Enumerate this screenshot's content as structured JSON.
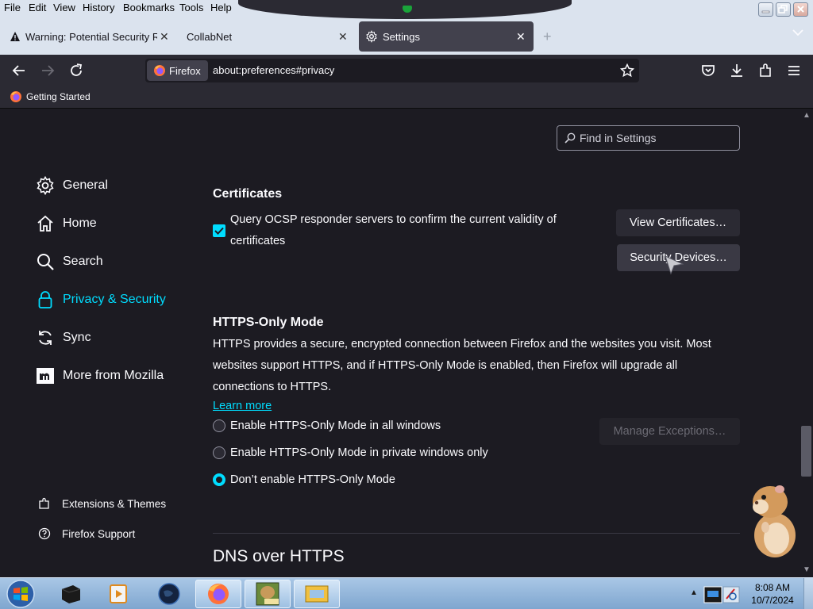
{
  "menubar": {
    "items": [
      {
        "label": "File"
      },
      {
        "label": "Edit"
      },
      {
        "label": "View"
      },
      {
        "label": "History"
      },
      {
        "label": "Bookmarks"
      },
      {
        "label": "Tools"
      },
      {
        "label": "Help"
      }
    ]
  },
  "tabs": [
    {
      "title": "Warning: Potential Security Risk",
      "icon": "warning-icon",
      "active": false
    },
    {
      "title": "CollabNet",
      "icon": "none",
      "active": false
    },
    {
      "title": "Settings",
      "icon": "gear-icon",
      "active": true
    }
  ],
  "navbar": {
    "identity_label": "Firefox",
    "url": "about:preferences#privacy"
  },
  "bookmarks": [
    {
      "label": "Getting Started",
      "icon": "firefox-icon"
    }
  ],
  "settings": {
    "find_placeholder": "Find in Settings",
    "categories": [
      {
        "label": "General",
        "icon": "gear-icon",
        "selected": false
      },
      {
        "label": "Home",
        "icon": "home-icon",
        "selected": false
      },
      {
        "label": "Search",
        "icon": "search-icon",
        "selected": false
      },
      {
        "label": "Privacy & Security",
        "icon": "lock-icon",
        "selected": true
      },
      {
        "label": "Sync",
        "icon": "sync-icon",
        "selected": false
      },
      {
        "label": "More from Mozilla",
        "icon": "mozilla-icon",
        "selected": false
      }
    ],
    "footer_links": [
      {
        "label": "Extensions & Themes",
        "icon": "puzzle-icon"
      },
      {
        "label": "Firefox Support",
        "icon": "help-icon"
      }
    ],
    "certificates": {
      "heading": "Certificates",
      "ocsp_line1": "Query OCSP responder servers to confirm the current validity of",
      "ocsp_line2": "certificates",
      "ocsp_checked": true,
      "view_certificates": "View Certificates…",
      "security_devices": "Security Devices…"
    },
    "https_only": {
      "heading": "HTTPS-Only Mode",
      "desc_line1": "HTTPS provides a secure, encrypted connection between Firefox and the websites you visit. Most",
      "desc_line2": "websites support HTTPS, and if HTTPS-Only Mode is enabled, then Firefox will upgrade all",
      "desc_line3": "connections to HTTPS.",
      "learn_more": "Learn more",
      "manage_exceptions": "Manage Exceptions…",
      "options": [
        {
          "label": "Enable HTTPS-Only Mode in all windows",
          "selected": false
        },
        {
          "label": "Enable HTTPS-Only Mode in private windows only",
          "selected": false
        },
        {
          "label": "Don’t enable HTTPS-Only Mode",
          "selected": true
        }
      ]
    },
    "dns_heading": "DNS over HTTPS"
  },
  "taskbar": {
    "clock_time": "8:08 AM",
    "clock_date": "10/7/2024",
    "apps": [
      "terminal-icon",
      "media-player-icon",
      "globe-icon",
      "firefox-icon",
      "game-box-icon",
      "mail-icon"
    ]
  },
  "colors": {
    "accent": "#00ddff",
    "page_bg": "#1c1b22",
    "toolbar_bg": "#2b2a33"
  }
}
